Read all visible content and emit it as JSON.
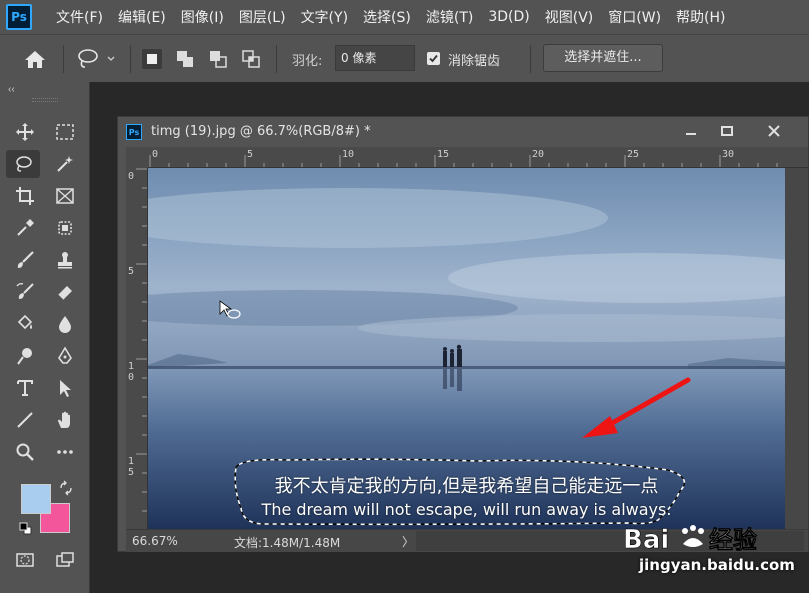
{
  "app": {
    "logo_text": "Ps"
  },
  "menu": [
    "文件(F)",
    "编辑(E)",
    "图像(I)",
    "图层(L)",
    "文字(Y)",
    "选择(S)",
    "滤镜(T)",
    "3D(D)",
    "视图(V)",
    "窗口(W)",
    "帮助(H)"
  ],
  "options": {
    "feather_label": "羽化:",
    "feather_value": "0 像素",
    "antialias_label": "消除锯齿",
    "antialias_checked": true,
    "select_mask_label": "选择并遮住..."
  },
  "toolbar": {
    "collapse": "‹‹",
    "fg_color": "#a9cdee",
    "bg_color": "#f3569a"
  },
  "document": {
    "icon_text": "Ps",
    "title": "timg (19).jpg @ 66.7%(RGB/8#) *",
    "ruler_top_labels": [
      "0",
      "5",
      "10",
      "15",
      "20",
      "25",
      "30"
    ],
    "ruler_left_labels": [
      "0",
      "5",
      "1",
      "0",
      "1",
      "5"
    ],
    "zoom": "66.67%",
    "doc_info": "文档:1.48M/1.48M",
    "status_arrow": "〉"
  },
  "image": {
    "caption_cn": "我不太肯定我的方向,但是我希望自己能走远一点",
    "caption_en": "The dream will not escape, will run away is always."
  },
  "watermark": {
    "brand": "Bai 经验",
    "url": "jingyan.baidu.com"
  }
}
